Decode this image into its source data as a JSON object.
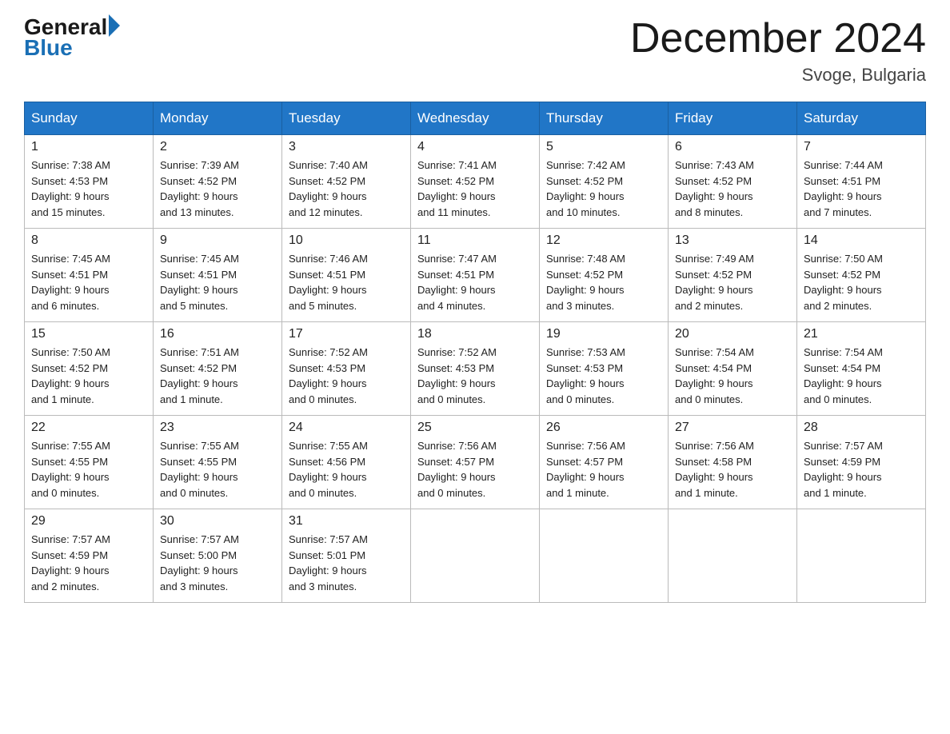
{
  "header": {
    "logo_general": "General",
    "logo_blue": "Blue",
    "month_title": "December 2024",
    "location": "Svoge, Bulgaria"
  },
  "weekdays": [
    "Sunday",
    "Monday",
    "Tuesday",
    "Wednesday",
    "Thursday",
    "Friday",
    "Saturday"
  ],
  "weeks": [
    [
      {
        "day": "1",
        "sunrise": "7:38 AM",
        "sunset": "4:53 PM",
        "daylight": "9 hours and 15 minutes."
      },
      {
        "day": "2",
        "sunrise": "7:39 AM",
        "sunset": "4:52 PM",
        "daylight": "9 hours and 13 minutes."
      },
      {
        "day": "3",
        "sunrise": "7:40 AM",
        "sunset": "4:52 PM",
        "daylight": "9 hours and 12 minutes."
      },
      {
        "day": "4",
        "sunrise": "7:41 AM",
        "sunset": "4:52 PM",
        "daylight": "9 hours and 11 minutes."
      },
      {
        "day": "5",
        "sunrise": "7:42 AM",
        "sunset": "4:52 PM",
        "daylight": "9 hours and 10 minutes."
      },
      {
        "day": "6",
        "sunrise": "7:43 AM",
        "sunset": "4:52 PM",
        "daylight": "9 hours and 8 minutes."
      },
      {
        "day": "7",
        "sunrise": "7:44 AM",
        "sunset": "4:51 PM",
        "daylight": "9 hours and 7 minutes."
      }
    ],
    [
      {
        "day": "8",
        "sunrise": "7:45 AM",
        "sunset": "4:51 PM",
        "daylight": "9 hours and 6 minutes."
      },
      {
        "day": "9",
        "sunrise": "7:45 AM",
        "sunset": "4:51 PM",
        "daylight": "9 hours and 5 minutes."
      },
      {
        "day": "10",
        "sunrise": "7:46 AM",
        "sunset": "4:51 PM",
        "daylight": "9 hours and 5 minutes."
      },
      {
        "day": "11",
        "sunrise": "7:47 AM",
        "sunset": "4:51 PM",
        "daylight": "9 hours and 4 minutes."
      },
      {
        "day": "12",
        "sunrise": "7:48 AM",
        "sunset": "4:52 PM",
        "daylight": "9 hours and 3 minutes."
      },
      {
        "day": "13",
        "sunrise": "7:49 AM",
        "sunset": "4:52 PM",
        "daylight": "9 hours and 2 minutes."
      },
      {
        "day": "14",
        "sunrise": "7:50 AM",
        "sunset": "4:52 PM",
        "daylight": "9 hours and 2 minutes."
      }
    ],
    [
      {
        "day": "15",
        "sunrise": "7:50 AM",
        "sunset": "4:52 PM",
        "daylight": "9 hours and 1 minute."
      },
      {
        "day": "16",
        "sunrise": "7:51 AM",
        "sunset": "4:52 PM",
        "daylight": "9 hours and 1 minute."
      },
      {
        "day": "17",
        "sunrise": "7:52 AM",
        "sunset": "4:53 PM",
        "daylight": "9 hours and 0 minutes."
      },
      {
        "day": "18",
        "sunrise": "7:52 AM",
        "sunset": "4:53 PM",
        "daylight": "9 hours and 0 minutes."
      },
      {
        "day": "19",
        "sunrise": "7:53 AM",
        "sunset": "4:53 PM",
        "daylight": "9 hours and 0 minutes."
      },
      {
        "day": "20",
        "sunrise": "7:54 AM",
        "sunset": "4:54 PM",
        "daylight": "9 hours and 0 minutes."
      },
      {
        "day": "21",
        "sunrise": "7:54 AM",
        "sunset": "4:54 PM",
        "daylight": "9 hours and 0 minutes."
      }
    ],
    [
      {
        "day": "22",
        "sunrise": "7:55 AM",
        "sunset": "4:55 PM",
        "daylight": "9 hours and 0 minutes."
      },
      {
        "day": "23",
        "sunrise": "7:55 AM",
        "sunset": "4:55 PM",
        "daylight": "9 hours and 0 minutes."
      },
      {
        "day": "24",
        "sunrise": "7:55 AM",
        "sunset": "4:56 PM",
        "daylight": "9 hours and 0 minutes."
      },
      {
        "day": "25",
        "sunrise": "7:56 AM",
        "sunset": "4:57 PM",
        "daylight": "9 hours and 0 minutes."
      },
      {
        "day": "26",
        "sunrise": "7:56 AM",
        "sunset": "4:57 PM",
        "daylight": "9 hours and 1 minute."
      },
      {
        "day": "27",
        "sunrise": "7:56 AM",
        "sunset": "4:58 PM",
        "daylight": "9 hours and 1 minute."
      },
      {
        "day": "28",
        "sunrise": "7:57 AM",
        "sunset": "4:59 PM",
        "daylight": "9 hours and 1 minute."
      }
    ],
    [
      {
        "day": "29",
        "sunrise": "7:57 AM",
        "sunset": "4:59 PM",
        "daylight": "9 hours and 2 minutes."
      },
      {
        "day": "30",
        "sunrise": "7:57 AM",
        "sunset": "5:00 PM",
        "daylight": "9 hours and 3 minutes."
      },
      {
        "day": "31",
        "sunrise": "7:57 AM",
        "sunset": "5:01 PM",
        "daylight": "9 hours and 3 minutes."
      },
      null,
      null,
      null,
      null
    ]
  ],
  "labels": {
    "sunrise": "Sunrise:",
    "sunset": "Sunset:",
    "daylight": "Daylight:"
  }
}
